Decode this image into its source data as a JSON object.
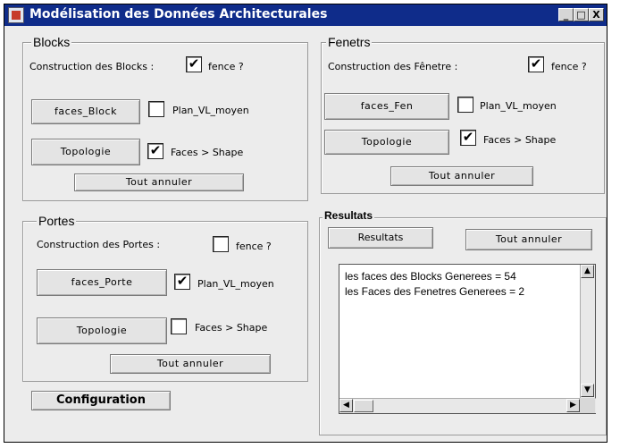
{
  "window": {
    "title": "Modélisation des Données Architecturales",
    "controls": {
      "minimize": "_",
      "maximize": "□",
      "close": "X"
    }
  },
  "blocks": {
    "legend": "Blocks",
    "construction_label": "Construction des Blocks :",
    "fence_label": "fence ?",
    "fence_checked": "✔",
    "faces_button": "faces_Block",
    "plan_label": "Plan_VL_moyen",
    "plan_checked": "",
    "topologie_button": "Topologie",
    "faces_shape_label": "Faces > Shape",
    "faces_shape_checked": "✔",
    "cancel_button": "Tout annuler"
  },
  "fenetres": {
    "legend": "Fenetrs",
    "construction_label": "Construction des Fênetre :",
    "fence_label": "fence ?",
    "fence_checked": "✔",
    "faces_button": "faces_Fen",
    "plan_label": "Plan_VL_moyen",
    "plan_checked": "",
    "topologie_button": "Topologie",
    "faces_shape_label": "Faces > Shape",
    "faces_shape_checked": "✔",
    "cancel_button": "Tout annuler"
  },
  "portes": {
    "legend": "Portes",
    "construction_label": "Construction des Portes :",
    "fence_label": "fence ?",
    "fence_checked": "",
    "faces_button": "faces_Porte",
    "plan_label": "Plan_VL_moyen",
    "plan_checked": "✔",
    "topologie_button": "Topologie",
    "faces_shape_label": "Faces > Shape",
    "faces_shape_checked": "",
    "cancel_button": "Tout annuler"
  },
  "resultats": {
    "legend": "Resultats",
    "results_button": "Resultats",
    "cancel_button": "Tout annuler",
    "lines": [
      "les faces des Blocks Generees = 54",
      "les Faces des Fenetres Generees = 2"
    ]
  },
  "configuration_button": "Configuration",
  "scroll": {
    "up": "▲",
    "down": "▼",
    "left": "◀",
    "right": "▶"
  }
}
